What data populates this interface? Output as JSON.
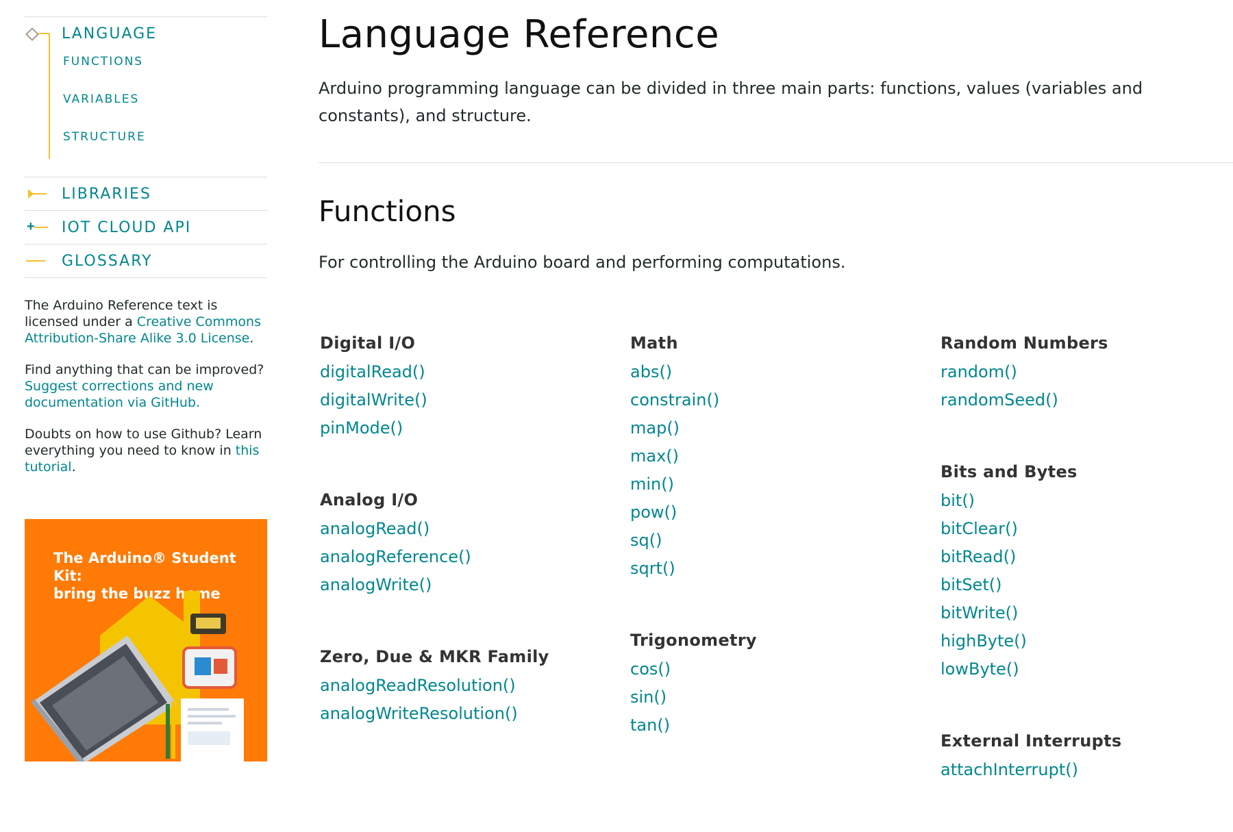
{
  "sidebar": {
    "language": {
      "label": "LANGUAGE",
      "subitems": [
        "FUNCTIONS",
        "VARIABLES",
        "STRUCTURE"
      ]
    },
    "libraries": "LIBRARIES",
    "iot_cloud_api": "IOT CLOUD API",
    "glossary": "GLOSSARY",
    "license": {
      "prefix": "The Arduino Reference text is licensed under a ",
      "link": "Creative Commons Attribution-Share Alike 3.0 License",
      "suffix": "."
    },
    "improve": {
      "prefix": "Find anything that can be improved? ",
      "link": "Suggest corrections and new documentation via GitHub."
    },
    "doubts": {
      "prefix": "Doubts on how to use Github? Learn everything you need to know in ",
      "link": "this tutorial",
      "suffix": "."
    },
    "promo": {
      "line1": "The Arduino® Student Kit:",
      "line2": "bring the buzz home",
      "background": "#ff7a06"
    }
  },
  "main": {
    "title": "Language Reference",
    "intro": "Arduino programming language can be divided in three main parts: functions, values (variables and constants), and structure.",
    "section_title": "Functions",
    "section_desc": "For controlling the Arduino board and performing computations."
  },
  "categories": {
    "digital_io": {
      "title": "Digital I/O",
      "items": [
        "digitalRead()",
        "digitalWrite()",
        "pinMode()"
      ]
    },
    "analog_io": {
      "title": "Analog I/O",
      "items": [
        "analogRead()",
        "analogReference()",
        "analogWrite()"
      ]
    },
    "zero_due_mkr": {
      "title": "Zero, Due & MKR Family",
      "items": [
        "analogReadResolution()",
        "analogWriteResolution()"
      ]
    },
    "math": {
      "title": "Math",
      "items": [
        "abs()",
        "constrain()",
        "map()",
        "max()",
        "min()",
        "pow()",
        "sq()",
        "sqrt()"
      ]
    },
    "trigonometry": {
      "title": "Trigonometry",
      "items": [
        "cos()",
        "sin()",
        "tan()"
      ]
    },
    "random_numbers": {
      "title": "Random Numbers",
      "items": [
        "random()",
        "randomSeed()"
      ]
    },
    "bits_and_bytes": {
      "title": "Bits and Bytes",
      "items": [
        "bit()",
        "bitClear()",
        "bitRead()",
        "bitSet()",
        "bitWrite()",
        "highByte()",
        "lowByte()"
      ]
    },
    "external_interrupts": {
      "title": "External Interrupts",
      "items": [
        "attachInterrupt()"
      ]
    }
  },
  "colors": {
    "link": "#00878f",
    "accent_yellow": "#f2c029",
    "promo_orange": "#ff7a06"
  }
}
